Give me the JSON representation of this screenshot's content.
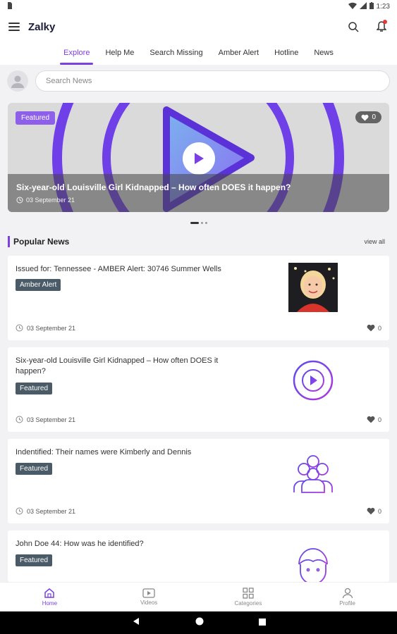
{
  "status_bar": {
    "time": "1:23"
  },
  "app": {
    "logo": "Zalky"
  },
  "tabs": [
    {
      "label": "Explore",
      "active": true
    },
    {
      "label": "Help Me"
    },
    {
      "label": "Search Missing"
    },
    {
      "label": "Amber Alert"
    },
    {
      "label": "Hotline"
    },
    {
      "label": "News"
    }
  ],
  "search": {
    "placeholder": "Search News"
  },
  "hero": {
    "badge": "Featured",
    "likes": "0",
    "title": "Six-year-old Louisville Girl Kidnapped – How often DOES it happen?",
    "date": "03 September 21"
  },
  "carousel": {
    "count": 3,
    "active": 0
  },
  "section": {
    "title": "Popular News",
    "view_all": "view all"
  },
  "news": [
    {
      "title": "Issued for: Tennessee - AMBER Alert: 30746 Summer Wells",
      "badge": "Amber Alert",
      "date": "03 September 21",
      "likes": "0",
      "thumb": "child-photo"
    },
    {
      "title": "Six-year-old Louisville Girl Kidnapped – How often DOES it happen?",
      "badge": "Featured",
      "date": "03 September 21",
      "likes": "0",
      "thumb": "play-circle-icon"
    },
    {
      "title": "Indentified: Their names were Kimberly and Dennis",
      "badge": "Featured",
      "date": "03 September 21",
      "likes": "0",
      "thumb": "group-people-icon"
    },
    {
      "title": "John Doe 44: How was he identified?",
      "badge": "Featured",
      "date": "",
      "likes": "",
      "thumb": "person-face-icon"
    }
  ],
  "bottom_nav": [
    {
      "label": "Home",
      "icon": "home-icon",
      "active": true
    },
    {
      "label": "Videos",
      "icon": "video-icon"
    },
    {
      "label": "Categories",
      "icon": "grid-icon"
    },
    {
      "label": "Profile",
      "icon": "user-icon"
    }
  ],
  "colors": {
    "accent": "#7b3fe4",
    "badge": "#4a5a66",
    "hero_badge": "#8e5fe8"
  }
}
